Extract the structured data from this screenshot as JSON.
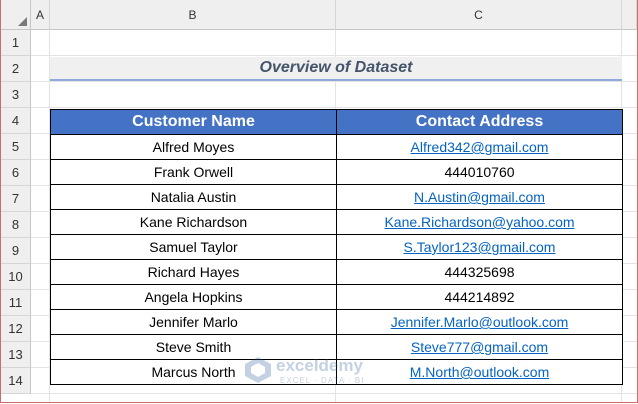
{
  "columns": [
    "A",
    "B",
    "C"
  ],
  "rows": [
    "1",
    "2",
    "3",
    "4",
    "5",
    "6",
    "7",
    "8",
    "9",
    "10",
    "11",
    "12",
    "13",
    "14"
  ],
  "title": "Overview of Dataset",
  "table": {
    "headers": [
      "Customer Name",
      "Contact Address"
    ],
    "rows": [
      {
        "name": "Alfred Moyes",
        "contact": "Alfred342@gmail.com",
        "is_link": true
      },
      {
        "name": "Frank Orwell",
        "contact": "444010760",
        "is_link": false
      },
      {
        "name": "Natalia Austin",
        "contact": "N.Austin@gmail.com",
        "is_link": true
      },
      {
        "name": "Kane Richardson",
        "contact": "Kane.Richardson@yahoo.com",
        "is_link": true
      },
      {
        "name": "Samuel Taylor",
        "contact": "S.Taylor123@gmail.com",
        "is_link": true
      },
      {
        "name": "Richard Hayes",
        "contact": "444325698",
        "is_link": false
      },
      {
        "name": "Angela Hopkins",
        "contact": "444214892",
        "is_link": false
      },
      {
        "name": "Jennifer Marlo",
        "contact": "Jennifer.Marlo@outlook.com",
        "is_link": true
      },
      {
        "name": "Steve Smith",
        "contact": "Steve777@gmail.com",
        "is_link": true
      },
      {
        "name": "Marcus North",
        "contact": "M.North@outlook.com",
        "is_link": true
      }
    ]
  },
  "watermark": {
    "name": "exceldemy",
    "tagline": "EXCEL · DATA · BI"
  },
  "colors": {
    "header_bg": "#4472c4",
    "link": "#0563c1",
    "title_text": "#44546a",
    "title_underline": "#8eaadb"
  }
}
